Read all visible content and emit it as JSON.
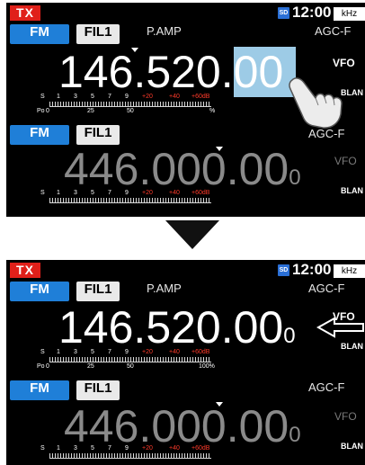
{
  "before": {
    "tx": "TX",
    "sd": "SD",
    "clock": "12:00",
    "unit": "kHz",
    "main": {
      "mode": "FM",
      "filter": "FIL1",
      "preamp": "P.AMP",
      "agc": "AGC-F",
      "vfo": "VFO",
      "blank": "BLAN",
      "freq_main": "146.520.",
      "freq_hl": "00",
      "freq_small": ""
    },
    "sub": {
      "mode": "FM",
      "filter": "FIL1",
      "agc": "AGC-F",
      "vfo": "VFO",
      "blank": "BLAN",
      "freq_main": "446.000.00",
      "freq_small": "0"
    },
    "meter_main": {
      "s": "S",
      "ticks": [
        "1",
        "3",
        "5",
        "7",
        "9"
      ],
      "red_ticks": [
        "+20",
        "+40",
        "+60dB"
      ],
      "po": "Po",
      "po_ticks": [
        "0",
        "25",
        "50"
      ],
      "po_end": "%"
    },
    "meter_sub": {
      "s": "S",
      "ticks": [
        "1",
        "3",
        "5",
        "7",
        "9"
      ],
      "red_ticks": [
        "+20",
        "+40",
        "+60dB"
      ]
    }
  },
  "after": {
    "tx": "TX",
    "sd": "SD",
    "clock": "12:00",
    "unit": "kHz",
    "main": {
      "mode": "FM",
      "filter": "FIL1",
      "preamp": "P.AMP",
      "agc": "AGC-F",
      "vfo": "VFO",
      "blank": "BLAN",
      "freq_main": "146.520.00",
      "freq_small": "0"
    },
    "sub": {
      "mode": "FM",
      "filter": "FIL1",
      "agc": "AGC-F",
      "vfo": "VFO",
      "blank": "BLAN",
      "freq_main": "446.000.00",
      "freq_small": "0"
    },
    "meter_main": {
      "s": "S",
      "ticks": [
        "1",
        "3",
        "5",
        "7",
        "9"
      ],
      "red_ticks": [
        "+20",
        "+40",
        "+60dB"
      ],
      "po": "Po",
      "po_ticks": [
        "0",
        "25",
        "50"
      ],
      "po_end": "100%"
    },
    "meter_sub": {
      "s": "S",
      "ticks": [
        "1",
        "3",
        "5",
        "7",
        "9"
      ],
      "red_ticks": [
        "+20",
        "+40",
        "+60dB"
      ]
    }
  },
  "colors": {
    "tx_red": "#e0201a",
    "mode_blue": "#1f7fd8",
    "highlight": "#9dcbe6",
    "meter_red": "#ff3a2a"
  },
  "icons": {
    "touch": "finger-tap-icon",
    "transition": "arrow-down-icon",
    "pointer": "arrow-left-icon"
  }
}
